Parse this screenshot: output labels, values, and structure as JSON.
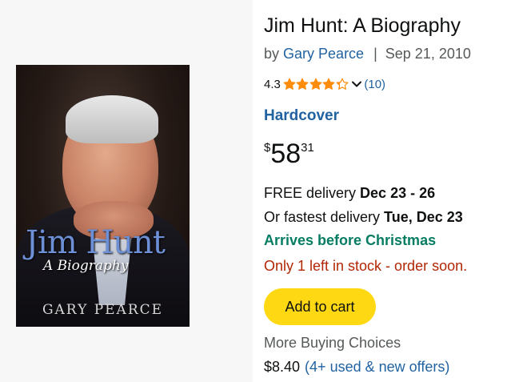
{
  "book": {
    "title": "Jim Hunt: A Biography",
    "by_prefix": "by",
    "author": "Gary Pearce",
    "separator": "|",
    "date": "Sep 21, 2010",
    "rating": "4.3",
    "rating_stars": 4.3,
    "rating_count": "(10)",
    "format": "Hardcover",
    "price": {
      "symbol": "$",
      "whole": "58",
      "fraction": "31"
    },
    "delivery": {
      "free_prefix": "FREE delivery ",
      "free_dates": "Dec 23 - 26",
      "fast_prefix": "Or fastest delivery ",
      "fast_date": "Tue, Dec 23"
    },
    "christmas": "Arrives before Christmas",
    "stock": "Only 1 left in stock - order soon.",
    "cart_label": "Add to cart",
    "more_buying": "More Buying Choices",
    "used_price": "$8.40",
    "offers_link": "(4+ used & new offers)"
  },
  "cover": {
    "title": "Jim Hunt",
    "subtitle": "A Biography",
    "author": "GARY PEARCE"
  },
  "icons": {
    "star": "star-icon",
    "chevron": "chevron-down-icon"
  },
  "colors": {
    "link": "#2162a1",
    "star": "#ff8c0a",
    "christmas": "#067d62",
    "stock": "#b12704",
    "cart_button": "#ffd814"
  }
}
